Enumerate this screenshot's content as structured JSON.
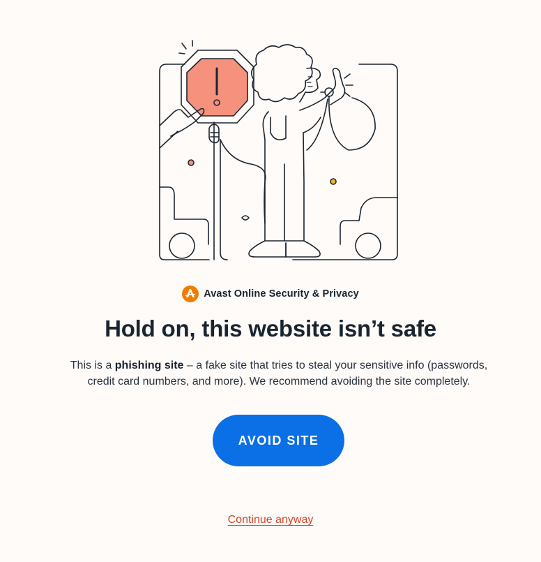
{
  "brand": {
    "logo_icon": "avast-logo-icon",
    "name": "Avast Online Security & Privacy"
  },
  "headline": "Hold on, this website isn’t safe",
  "description": {
    "prefix": "This is a ",
    "emphasis": "phishing site",
    "suffix": " – a fake site that tries to steal your sensitive info (passwords, credit card numbers, and more). We recommend avoiding the site completely."
  },
  "actions": {
    "avoid_label": "AVOID SITE",
    "continue_label": "Continue anyway"
  },
  "colors": {
    "background": "#fffbf8",
    "primary_button": "#0b6fe6",
    "link": "#d2452a",
    "stop_sign": "#f5917c",
    "brand_orange": "#f07c00"
  }
}
